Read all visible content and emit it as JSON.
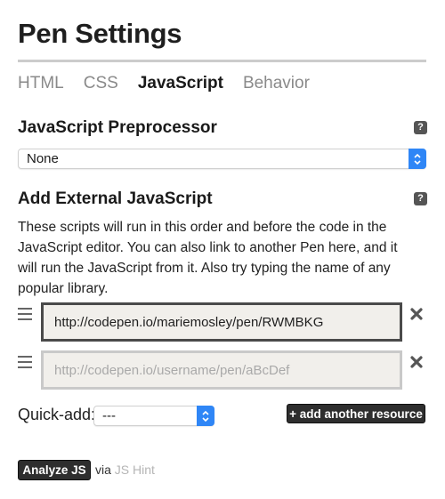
{
  "header": {
    "title": "Pen Settings"
  },
  "tabs": [
    {
      "label": "HTML",
      "active": false
    },
    {
      "label": "CSS",
      "active": false
    },
    {
      "label": "JavaScript",
      "active": true
    },
    {
      "label": "Behavior",
      "active": false
    }
  ],
  "preprocessor": {
    "title": "JavaScript Preprocessor",
    "help_icon": "?",
    "selected": "None"
  },
  "external": {
    "title": "Add External JavaScript",
    "help_icon": "?",
    "description": "These scripts will run in this order and before the code in the JavaScript editor. You can also link to another Pen here, and it will run the JavaScript from it. Also try typing the name of any popular library.",
    "resources": [
      {
        "value": "http://codepen.io/mariemosley/pen/RWMBKG",
        "placeholder": "http://codepen.io/username/pen/aBcDef"
      },
      {
        "value": "",
        "placeholder": "http://codepen.io/username/pen/aBcDef"
      }
    ],
    "quick_add_label": "Quick-add:",
    "quick_add_selected": "---",
    "add_resource_label": "+ add another resource"
  },
  "analyze": {
    "button_label": "Analyze JS",
    "via_text": "via",
    "link_text": "JS Hint"
  },
  "colors": {
    "select_accent": "#2f86f6",
    "dark_button": "#2e2e2e",
    "input_bg": "#f1efeb"
  }
}
